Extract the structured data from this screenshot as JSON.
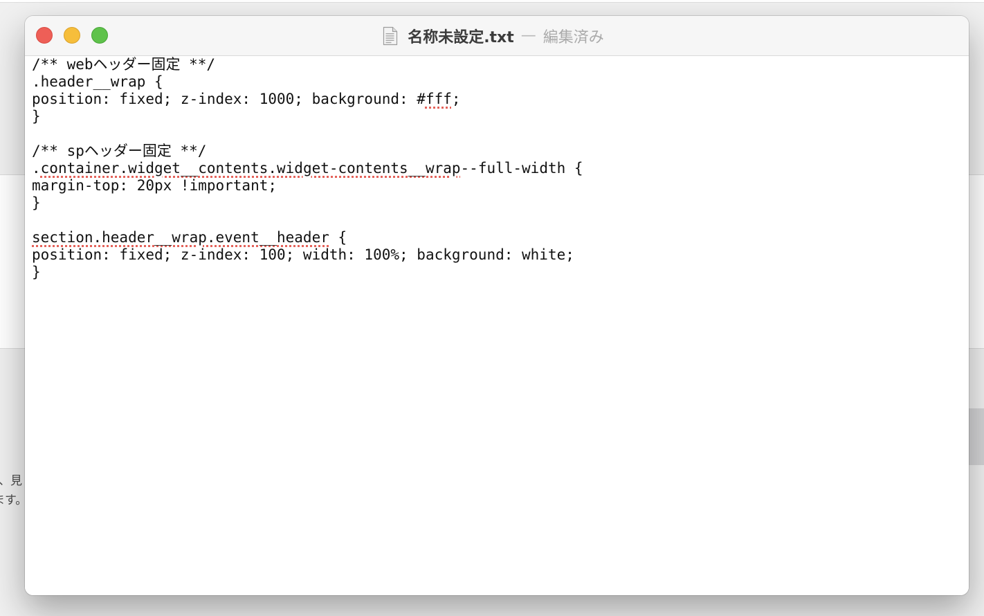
{
  "background": {
    "text_line_1": "、見",
    "text_line_2": "ます。"
  },
  "window": {
    "title": "名称未設定.txt",
    "separator": "—",
    "status": "編集済み",
    "icons": {
      "close": "close-dot-icon",
      "minimize": "minimize-dot-icon",
      "zoom": "zoom-dot-icon",
      "document": "text-document-icon"
    },
    "colors": {
      "close": "#ee5f57",
      "minimize": "#f6be3b",
      "zoom": "#5fc24b",
      "spellcheck_underline": "#e4625a"
    }
  },
  "editor": {
    "lines": [
      {
        "segments": [
          {
            "text": "/** webヘッダー固定 **/"
          }
        ]
      },
      {
        "segments": [
          {
            "text": ".header__wrap {"
          }
        ]
      },
      {
        "segments": [
          {
            "text": "position: fixed; z-index: 1000; background: #"
          },
          {
            "text": "fff",
            "spell": true
          },
          {
            "text": ";"
          }
        ]
      },
      {
        "segments": [
          {
            "text": "}"
          }
        ]
      },
      {
        "segments": [
          {
            "text": ""
          }
        ]
      },
      {
        "segments": [
          {
            "text": "/** spヘッダー固定 **/"
          }
        ]
      },
      {
        "segments": [
          {
            "text": "."
          },
          {
            "text": "container.widget__contents.widget-contents__wrap",
            "spell": true
          },
          {
            "text": "--full-width {"
          }
        ]
      },
      {
        "segments": [
          {
            "text": "margin-top: 20px !important;"
          }
        ]
      },
      {
        "segments": [
          {
            "text": "}"
          }
        ]
      },
      {
        "segments": [
          {
            "text": ""
          }
        ]
      },
      {
        "segments": [
          {
            "text": "section.header__wrap.event__header",
            "spell": true
          },
          {
            "text": " {"
          }
        ]
      },
      {
        "segments": [
          {
            "text": "position: fixed; z-index: 100; width: 100%; background: white;"
          }
        ]
      },
      {
        "segments": [
          {
            "text": "}"
          }
        ]
      }
    ]
  }
}
